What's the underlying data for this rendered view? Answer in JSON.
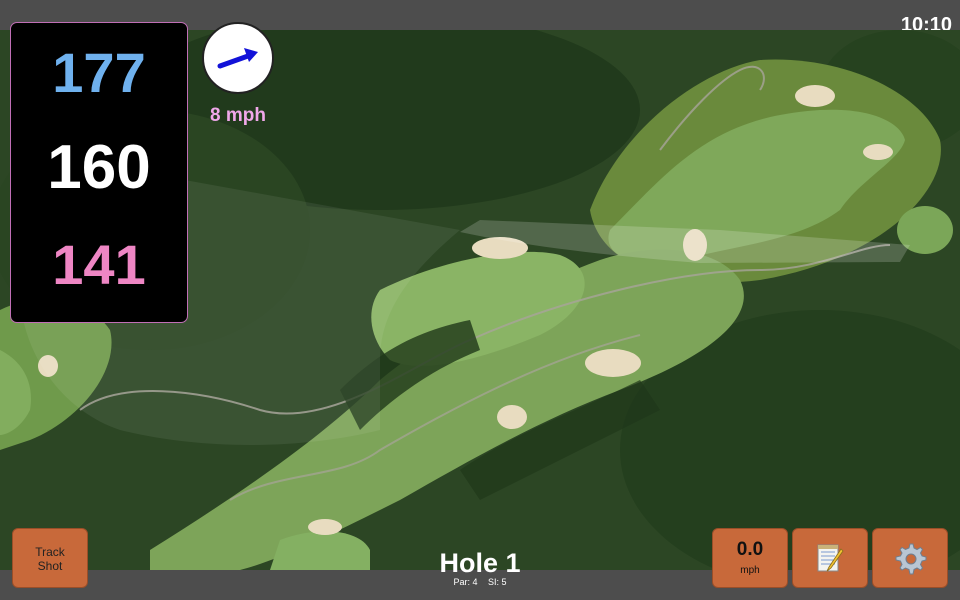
{
  "status": {
    "time": "10:10"
  },
  "distances": {
    "back": "177",
    "middle": "160",
    "front": "141"
  },
  "wind": {
    "speed_label": "8 mph",
    "icon": "wind-direction-arrow-icon"
  },
  "hole": {
    "title": "Hole 1",
    "par": "Par: 4",
    "si": "SI: 5"
  },
  "buttons": {
    "track_shot": "Track Shot",
    "speed_value": "0.0",
    "speed_unit": "mph",
    "notes_icon": "notepad-icon",
    "settings_icon": "gear-icon"
  },
  "colors": {
    "back_distance": "#6fb1ee",
    "middle_distance": "#ffffff",
    "front_distance": "#ee86c4",
    "button": "#c8693a",
    "wind_label": "#f0a8ea"
  }
}
